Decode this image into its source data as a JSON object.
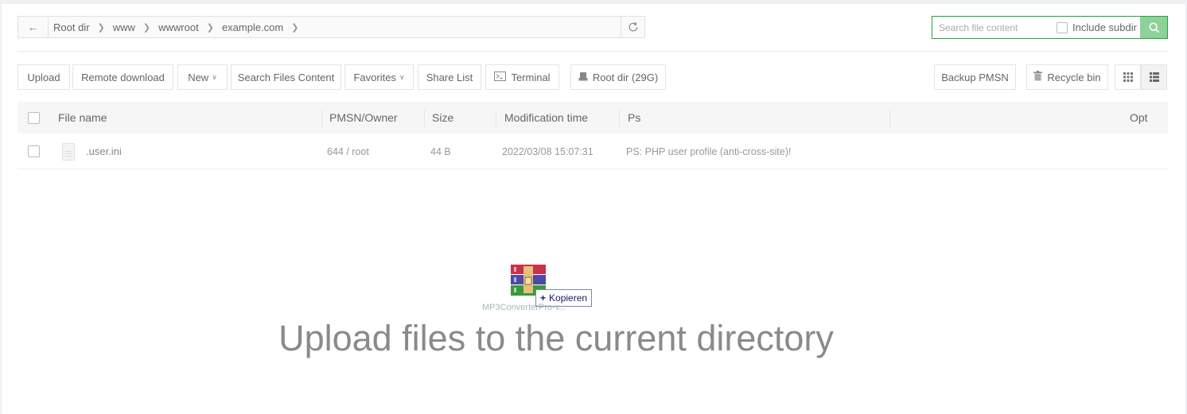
{
  "breadcrumb": [
    "Root dir",
    "www",
    "wwwroot",
    "example.com"
  ],
  "search": {
    "placeholder": "Search file content",
    "include_subdir_label": "Include subdir"
  },
  "toolbar": {
    "upload": "Upload",
    "remote_download": "Remote download",
    "new": "New",
    "search_files_content": "Search Files Content",
    "favorites": "Favorites",
    "share_list": "Share List",
    "terminal": "Terminal",
    "root_dir": "Root dir (29G)",
    "backup_pmsn": "Backup PMSN",
    "recycle_bin": "Recycle bin"
  },
  "table": {
    "columns": {
      "file_name": "File name",
      "pmsn_owner": "PMSN/Owner",
      "size": "Size",
      "modification_time": "Modification time",
      "ps": "Ps",
      "opt": "Opt"
    },
    "rows": [
      {
        "name": ".user.ini",
        "pmsn_owner": "644 / root",
        "size": "44 B",
        "modified": "2022/03/08 15:07:31",
        "ps": "PS: PHP user profile (anti-cross-site)!"
      }
    ]
  },
  "drop_zone": {
    "message": "Upload files to the current directory",
    "drag_tooltip": "Kopieren",
    "drag_filename": "MP3ConverterPro-v..."
  },
  "colors": {
    "accent": "#20a53a",
    "border": "#e4e4e4"
  }
}
